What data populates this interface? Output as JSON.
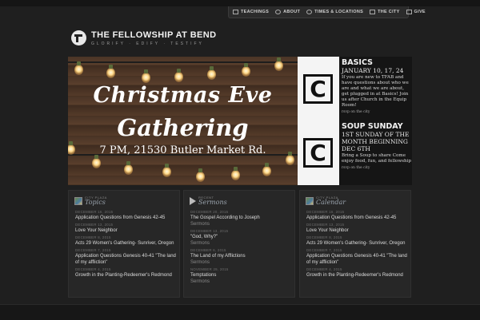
{
  "nav": {
    "items": [
      {
        "label": "TEACHINGS",
        "icon": "teachings-icon"
      },
      {
        "label": "ABOUT",
        "icon": "people-icon"
      },
      {
        "label": "TIMES & LOCATIONS",
        "icon": "globe-icon"
      },
      {
        "label": "THE CITY",
        "icon": "city-icon"
      },
      {
        "label": "GIVE",
        "icon": "give-icon"
      }
    ]
  },
  "logo": {
    "title": "THE FELLOWSHIP AT BEND",
    "tagline": "GLORIFY  ·  EDIFY  ·  TESTIFY"
  },
  "hero": {
    "line1": "Christmas Eve",
    "line2": "Gathering",
    "subline": "7 PM, 21530 Butler Market Rd."
  },
  "side": {
    "icon_letter": "C",
    "basics": {
      "title": "BASICS",
      "date": "JANUARY 10, 17, 24",
      "body": "If you are new to TFAB and have questions about who we are and what we are about, get plugged in at Basics! Join us after Church in the Equip Room!",
      "link": "rsvp on the city"
    },
    "soup": {
      "title": "SOUP SUNDAY",
      "date": "1ST SUNDAY OF THE MONTH BEGINNING DEC 6TH",
      "body": "Bring a Soup to share Come enjoy food, fun, and fellowship",
      "link": "rsvp on the city"
    }
  },
  "columns": {
    "topics": {
      "kicker": "CITY PLAZA",
      "title": "Topics",
      "items": [
        {
          "date": "DECEMBER 16, 2015",
          "title": "Application Questions from Genesis 42-45"
        },
        {
          "date": "DECEMBER 13, 2015",
          "title": "Love Your Neighbor"
        },
        {
          "date": "DECEMBER 8, 2015",
          "title": "Acts 29 Women's Gathering- Sunriver, Oregon"
        },
        {
          "date": "DECEMBER 7, 2015",
          "title": "Application Questions Genesis 40-41 \"The land of my affliction\""
        },
        {
          "date": "DECEMBER 4, 2015",
          "title": "Growth in the Planting-Redeemer's Redmond"
        }
      ]
    },
    "sermons": {
      "kicker": "RECENT",
      "title": "Sermons",
      "items": [
        {
          "date": "DECEMBER 20, 2015",
          "title": "The Gospel According to Joseph",
          "sub": "Sermons"
        },
        {
          "date": "DECEMBER 13, 2015",
          "title": "\"God, Why?\"",
          "sub": "Sermons"
        },
        {
          "date": "DECEMBER 6, 2015",
          "title": "The Land of my Afflictions",
          "sub": "Sermons"
        },
        {
          "date": "NOVEMBER 29, 2015",
          "title": "Temptations",
          "sub": "Sermons"
        }
      ]
    },
    "calendar": {
      "kicker": "CITY PLAZA",
      "title": "Calendar",
      "items": [
        {
          "date": "DECEMBER 16, 2015",
          "title": "Application Questions from Genesis 42-45"
        },
        {
          "date": "DECEMBER 13, 2015",
          "title": "Love Your Neighbor"
        },
        {
          "date": "DECEMBER 8, 2015",
          "title": "Acts 29 Women's Gathering- Sunriver, Oregon"
        },
        {
          "date": "DECEMBER 7, 2015",
          "title": "Application Questions Genesis 40-41 \"The land of my affliction\""
        },
        {
          "date": "DECEMBER 4, 2015",
          "title": "Growth in the Planting-Redeemer's Redmond"
        }
      ]
    }
  }
}
